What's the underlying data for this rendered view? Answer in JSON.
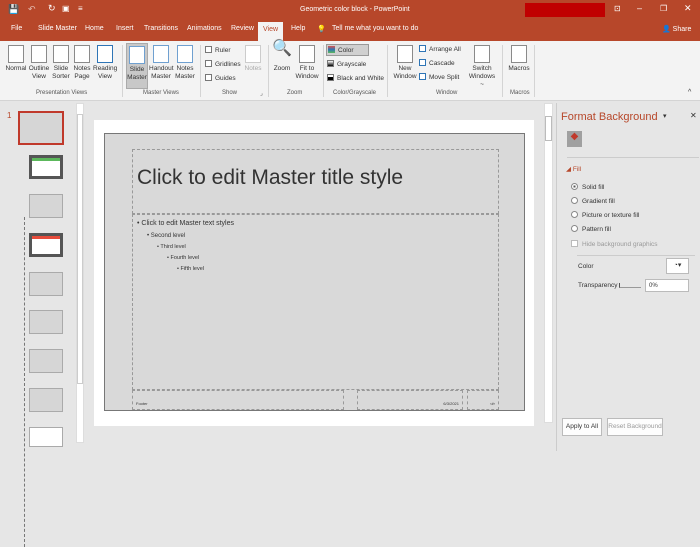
{
  "window": {
    "title": "Geometric color block - PowerPoint",
    "share": "Share",
    "redacted_color": "#c00000",
    "accent": "#b7472a"
  },
  "tabs": [
    "File",
    "Slide Master",
    "Home",
    "Insert",
    "Transitions",
    "Animations",
    "Review",
    "View",
    "Help"
  ],
  "active_tab": "View",
  "tell_me": "Tell me what you want to do",
  "ribbon": {
    "presentation_views": {
      "label": "Presentation Views",
      "items": [
        [
          "Normal",
          ""
        ],
        [
          "Outline",
          "View"
        ],
        [
          "Slide",
          "Sorter"
        ],
        [
          "Notes",
          "Page"
        ],
        [
          "Reading",
          "View"
        ]
      ]
    },
    "master_views": {
      "label": "Master Views",
      "items": [
        [
          "Slide",
          "Master"
        ],
        [
          "Handout",
          "Master"
        ],
        [
          "Notes",
          "Master"
        ]
      ]
    },
    "show": {
      "label": "Show",
      "ruler": "Ruler",
      "gridlines": "Gridlines",
      "guides": "Guides",
      "notes": "Notes"
    },
    "zoom": {
      "label": "Zoom",
      "zoom": "Zoom",
      "fit1": "Fit to",
      "fit2": "Window"
    },
    "color": {
      "label": "Color/Grayscale",
      "color": "Color",
      "grayscale": "Grayscale",
      "bw": "Black and White"
    },
    "window": {
      "label": "Window",
      "new1": "New",
      "new2": "Window",
      "arrange": "Arrange All",
      "cascade": "Cascade",
      "move": "Move Split",
      "switch1": "Switch",
      "switch2": "Windows ~"
    },
    "macros": {
      "label": "Macros",
      "macros": "Macros"
    }
  },
  "thumbnails": {
    "selected_number": "1",
    "count": 9
  },
  "slide": {
    "title": "Click to edit Master title style",
    "levels": [
      "Click to edit Master text styles",
      "Second level",
      "Third level",
      "Fourth level",
      "Fifth level"
    ],
    "footer": "Footer",
    "date": "6/3/2021",
    "page": "‹#›"
  },
  "format_pane": {
    "title": "Format Background",
    "fill": "Fill",
    "options": [
      "Solid fill",
      "Gradient fill",
      "Picture or texture fill",
      "Pattern fill"
    ],
    "selected": "Solid fill",
    "hide": "Hide background graphics",
    "color": "Color",
    "transparency": "Transparency",
    "transparency_value": "0%",
    "apply_all": "Apply to All",
    "reset": "Reset Background"
  }
}
